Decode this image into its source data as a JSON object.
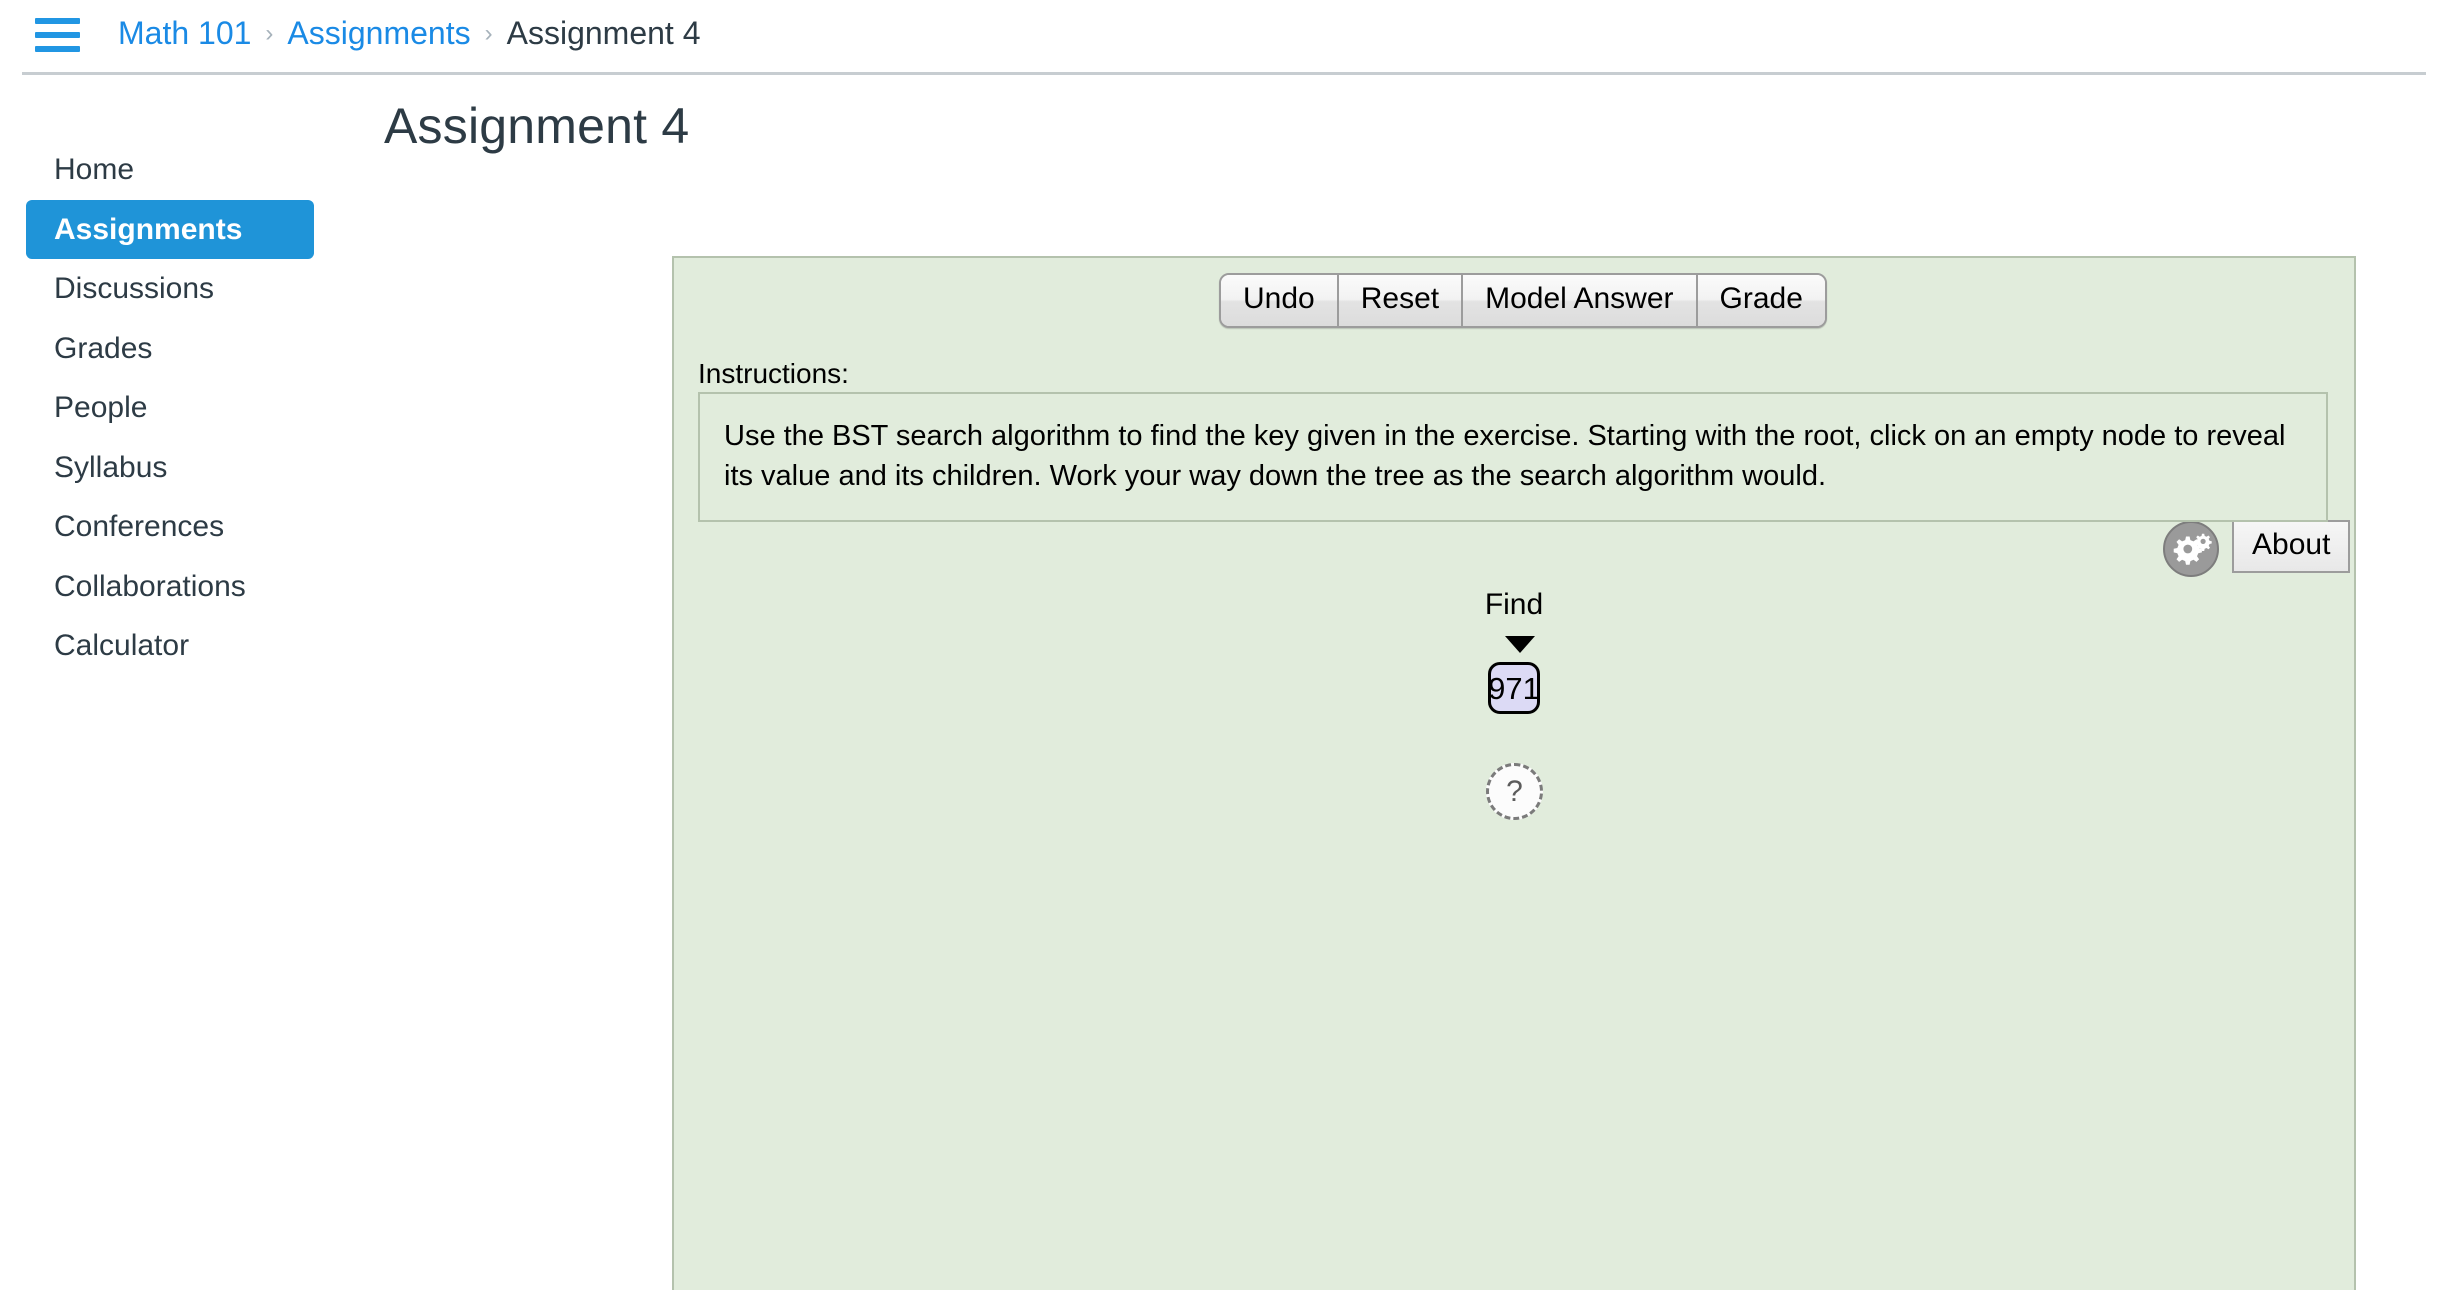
{
  "topbar": {
    "menu_icon": "hamburger-icon",
    "breadcrumb": {
      "course": "Math 101",
      "section": "Assignments",
      "current": "Assignment 4",
      "separator": "›"
    }
  },
  "page": {
    "title": "Assignment 4"
  },
  "sidebar": {
    "items": [
      {
        "label": "Home",
        "active": false
      },
      {
        "label": "Assignments",
        "active": true
      },
      {
        "label": "Discussions",
        "active": false
      },
      {
        "label": "Grades",
        "active": false
      },
      {
        "label": "People",
        "active": false
      },
      {
        "label": "Syllabus",
        "active": false
      },
      {
        "label": "Conferences",
        "active": false
      },
      {
        "label": "Collaborations",
        "active": false
      },
      {
        "label": "Calculator",
        "active": false
      }
    ],
    "active_color": "#1f94d8",
    "active_text_color": "#ffffff"
  },
  "exercise": {
    "panel_background": "#e1ecdc",
    "panel_border": "#b4c2ad",
    "toolbar": {
      "undo_label": "Undo",
      "reset_label": "Reset",
      "model_answer_label": "Model Answer",
      "grade_label": "Grade"
    },
    "logo_icon": "gears-logo-icon",
    "about_label": "About",
    "instructions_label": "Instructions:",
    "instructions_text": "Use the BST search algorithm to find the key given in the exercise. Starting with the root, click on an empty node to reveal its value and its children. Work your way down the tree as the search algorithm would.",
    "tree": {
      "find_label": "Find",
      "find_arrow_icon": "down-triangle-icon",
      "key_value": "971",
      "key_node_color": "#dcdaf5",
      "root_node_placeholder": "?"
    }
  }
}
